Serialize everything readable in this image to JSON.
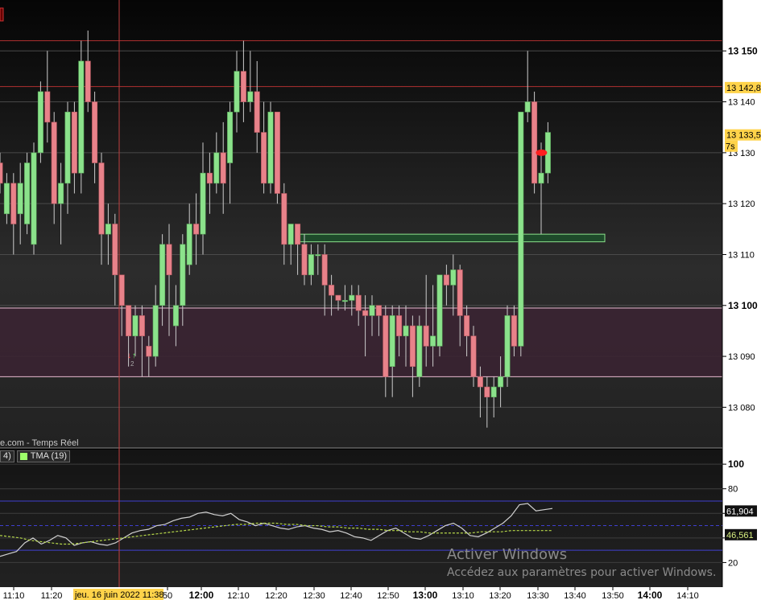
{
  "source_label": "e.com - Temps Réel",
  "legend": {
    "first": "4)",
    "tma": "TMA (19)"
  },
  "watermark": {
    "title": "Activer Windows",
    "subtitle": "Accédez aux paramètres pour activer Windows."
  },
  "colors": {
    "up": "#8be28b",
    "down": "#e8828a",
    "zone": "#3a2432",
    "resistance": "#b03030",
    "indicator": "#d0d0d0",
    "tma": "#b6d84a",
    "band": "#4040d0"
  },
  "chart_data": [
    {
      "type": "candlestick",
      "ylim": [
        13072,
        13160
      ],
      "y_ticks": [
        {
          "value": 13150,
          "label": "13 150",
          "major": true
        },
        {
          "value": 13140,
          "label": "13 140",
          "major": false
        },
        {
          "value": 13130,
          "label": "13 130",
          "major": false
        },
        {
          "value": 13120,
          "label": "13 120",
          "major": false
        },
        {
          "value": 13110,
          "label": "13 110",
          "major": false
        },
        {
          "value": 13100,
          "label": "13 100",
          "major": true
        },
        {
          "value": 13090,
          "label": "13 090",
          "major": false
        },
        {
          "value": 13080,
          "label": "13 080",
          "major": false
        }
      ],
      "price_tags": [
        {
          "value": 13142.8,
          "label": "13 142,8"
        },
        {
          "value": 13133.5,
          "label": "13 133,5"
        }
      ],
      "countdown": "7s",
      "x_ticks": [
        {
          "label": "11:10",
          "major": false
        },
        {
          "label": "11:20",
          "major": false
        },
        {
          "label": "50",
          "major": false
        },
        {
          "label": "12:00",
          "major": true
        },
        {
          "label": "12:10",
          "major": false
        },
        {
          "label": "12:20",
          "major": false
        },
        {
          "label": "12:30",
          "major": false
        },
        {
          "label": "12:40",
          "major": false
        },
        {
          "label": "12:50",
          "major": false
        },
        {
          "label": "13:00",
          "major": true
        },
        {
          "label": "13:10",
          "major": false
        },
        {
          "label": "13:20",
          "major": false
        },
        {
          "label": "13:30",
          "major": false
        },
        {
          "label": "13:40",
          "major": false
        },
        {
          "label": "13:50",
          "major": false
        },
        {
          "label": "14:00",
          "major": true
        },
        {
          "label": "14:10",
          "major": false
        }
      ],
      "crosshair_label": "jeu. 16 juin 2022 11:38",
      "resistance_lines": [
        13152,
        13143
      ],
      "zone": {
        "top": 13099.5,
        "bottom": 13086
      },
      "zone_box": {
        "top": 13114,
        "bottom": 13112.5
      },
      "candles": [
        [
          13128,
          13124,
          13122,
          13130
        ],
        [
          13118,
          13124,
          13116,
          13126
        ],
        [
          13124,
          13116,
          13110,
          13126
        ],
        [
          13118,
          13124,
          13112,
          13128
        ],
        [
          13116,
          13128,
          13114,
          13130
        ],
        [
          13112,
          13130,
          13110,
          13132
        ],
        [
          13130,
          13142,
          13128,
          13144
        ],
        [
          13142,
          13136,
          13132,
          13150
        ],
        [
          13136,
          13120,
          13116,
          13138
        ],
        [
          13120,
          13124,
          13112,
          13128
        ],
        [
          13124,
          13138,
          13118,
          13140
        ],
        [
          13138,
          13126,
          13122,
          13140
        ],
        [
          13126,
          13148,
          13122,
          13152
        ],
        [
          13148,
          13140,
          13138,
          13154
        ],
        [
          13140,
          13128,
          13124,
          13142
        ],
        [
          13128,
          13114,
          13108,
          13130
        ],
        [
          13114,
          13116,
          13108,
          13120
        ],
        [
          13116,
          13106,
          13100,
          13118
        ],
        [
          13106,
          13100,
          13094,
          13106
        ],
        [
          13100,
          13094,
          13088,
          13098
        ],
        [
          13094,
          13098,
          13090,
          13100
        ],
        [
          13098,
          13094,
          13086,
          13100
        ],
        [
          13092,
          13090,
          13086,
          13094
        ],
        [
          13090,
          13100,
          13088,
          13104
        ],
        [
          13100,
          13112,
          13096,
          13114
        ],
        [
          13112,
          13106,
          13094,
          13116
        ],
        [
          13096,
          13100,
          13092,
          13104
        ],
        [
          13100,
          13112,
          13096,
          13114
        ],
        [
          13108,
          13116,
          13106,
          13120
        ],
        [
          13116,
          13114,
          13108,
          13122
        ],
        [
          13114,
          13126,
          13110,
          13132
        ],
        [
          13126,
          13124,
          13118,
          13130
        ],
        [
          13124,
          13130,
          13122,
          13134
        ],
        [
          13130,
          13124,
          13118,
          13136
        ],
        [
          13128,
          13138,
          13120,
          13140
        ],
        [
          13138,
          13146,
          13134,
          13150
        ],
        [
          13146,
          13140,
          13136,
          13152
        ],
        [
          13140,
          13142,
          13138,
          13150
        ],
        [
          13142,
          13134,
          13130,
          13148
        ],
        [
          13134,
          13124,
          13122,
          13140
        ],
        [
          13124,
          13138,
          13122,
          13140
        ],
        [
          13138,
          13122,
          13120,
          13138
        ],
        [
          13122,
          13112,
          13108,
          13124
        ],
        [
          13112,
          13116,
          13108,
          13116
        ],
        [
          13116,
          13112,
          13106,
          13116
        ],
        [
          13112,
          13106,
          13104,
          13114
        ],
        [
          13106,
          13110,
          13104,
          13112
        ],
        [
          13110,
          13110,
          13106,
          13112
        ],
        [
          13110,
          13104,
          13098,
          13112
        ],
        [
          13104,
          13102,
          13098,
          13106
        ],
        [
          13102,
          13101,
          13099,
          13102
        ],
        [
          13101,
          13101,
          13099,
          13104
        ],
        [
          13101,
          13102,
          13098,
          13104
        ],
        [
          13102,
          13099,
          13096,
          13104
        ],
        [
          13099,
          13098,
          13090,
          13102
        ],
        [
          13098,
          13100,
          13094,
          13102
        ],
        [
          13100,
          13098,
          13094,
          13100
        ],
        [
          13098,
          13086,
          13082,
          13100
        ],
        [
          13088,
          13098,
          13082,
          13100
        ],
        [
          13098,
          13094,
          13090,
          13100
        ],
        [
          13094,
          13096,
          13088,
          13100
        ],
        [
          13096,
          13088,
          13082,
          13098
        ],
        [
          13086,
          13096,
          13084,
          13098
        ],
        [
          13096,
          13092,
          13088,
          13106
        ],
        [
          13092,
          13094,
          13088,
          13104
        ],
        [
          13092,
          13106,
          13090,
          13106
        ],
        [
          13106,
          13104,
          13100,
          13108
        ],
        [
          13104,
          13107,
          13098,
          13110
        ],
        [
          13107,
          13098,
          13092,
          13108
        ],
        [
          13098,
          13094,
          13090,
          13100
        ],
        [
          13094,
          13086,
          13084,
          13096
        ],
        [
          13086,
          13084,
          13078,
          13088
        ],
        [
          13084,
          13082,
          13076,
          13086
        ],
        [
          13082,
          13084,
          13078,
          13086
        ],
        [
          13084,
          13086,
          13080,
          13090
        ],
        [
          13086,
          13098,
          13084,
          13100
        ],
        [
          13098,
          13092,
          13090,
          13100
        ],
        [
          13092,
          13138,
          13090,
          13138
        ],
        [
          13138,
          13140,
          13136,
          13150
        ],
        [
          13140,
          13124,
          13122,
          13142
        ],
        [
          13124,
          13126,
          13114,
          13132
        ],
        [
          13126,
          13134,
          13124,
          13136
        ]
      ]
    },
    {
      "type": "line",
      "ylim": [
        0,
        100
      ],
      "y_ticks": [
        {
          "value": 100,
          "label": "100",
          "major": true
        },
        {
          "value": 80,
          "label": "80",
          "major": false
        },
        {
          "value": 60,
          "label": "",
          "major": false
        },
        {
          "value": 40,
          "label": "",
          "major": false
        },
        {
          "value": 20,
          "label": "20",
          "major": false
        }
      ],
      "bands": [
        70,
        30,
        50
      ],
      "value_tags": [
        {
          "value": 61.904,
          "label": "61,904"
        },
        {
          "value": 46.561,
          "label": "46,561"
        }
      ],
      "series": [
        {
          "values": [
            25,
            27,
            29,
            36,
            40,
            35,
            38,
            42,
            40,
            34,
            36,
            37,
            35,
            34,
            36,
            40,
            44,
            46,
            47,
            50,
            51,
            54,
            56,
            57,
            60,
            61,
            59,
            58,
            60,
            55,
            53,
            50,
            52,
            50,
            48,
            47,
            49,
            50,
            48,
            47,
            45,
            46,
            44,
            41,
            40,
            38,
            42,
            46,
            48,
            44,
            40,
            39,
            42,
            46,
            50,
            52,
            48,
            42,
            41,
            44,
            48,
            52,
            58,
            67,
            68,
            62,
            63,
            64
          ]
        },
        {
          "values": [
            42,
            41,
            40,
            38,
            37,
            36,
            35,
            35,
            36,
            37,
            38,
            39,
            40,
            41,
            42,
            43,
            44,
            45,
            46,
            47,
            48,
            49,
            50,
            51,
            51,
            52,
            52,
            52,
            51,
            51,
            50,
            50,
            49,
            49,
            48,
            48,
            47,
            47,
            46,
            46,
            45,
            45,
            44,
            44,
            44,
            44,
            44,
            45,
            45,
            45,
            46,
            46,
            46,
            46,
            46
          ]
        }
      ]
    }
  ]
}
